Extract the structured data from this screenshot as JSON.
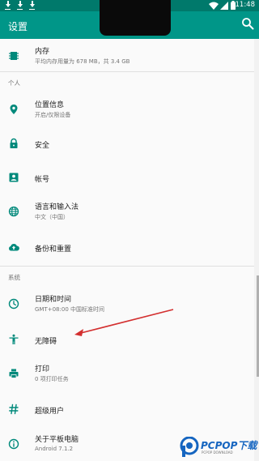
{
  "status_bar": {
    "time": "11:48"
  },
  "app_bar": {
    "title": "设置"
  },
  "items": [
    {
      "id": "storage",
      "title": "内存",
      "subtitle": "平均内存用量为 678 MB，共 3.4 GB"
    },
    {
      "id": "location",
      "title": "位置信息",
      "subtitle": "开启/仅限设备"
    },
    {
      "id": "security",
      "title": "安全"
    },
    {
      "id": "accounts",
      "title": "帐号"
    },
    {
      "id": "language",
      "title": "语言和输入法",
      "subtitle": "中文（中国）"
    },
    {
      "id": "backup",
      "title": "备份和重置"
    },
    {
      "id": "datetime",
      "title": "日期和时间",
      "subtitle": "GMT+08:00 中国标准时间"
    },
    {
      "id": "accessibility",
      "title": "无障碍"
    },
    {
      "id": "printing",
      "title": "打印",
      "subtitle": "0 项打印任务"
    },
    {
      "id": "superuser",
      "title": "超级用户"
    },
    {
      "id": "about",
      "title": "关于平板电脑",
      "subtitle": "Android 7.1.2"
    }
  ],
  "sections": {
    "personal": "个人",
    "system": "系统"
  },
  "watermark": {
    "text": "PCPOP下载",
    "sub": "PCPOP DOWNLOAD"
  },
  "colors": {
    "primary": "#009688",
    "primary_dark": "#00796b",
    "icon": "#00897b",
    "arrow": "#d32f2f"
  }
}
